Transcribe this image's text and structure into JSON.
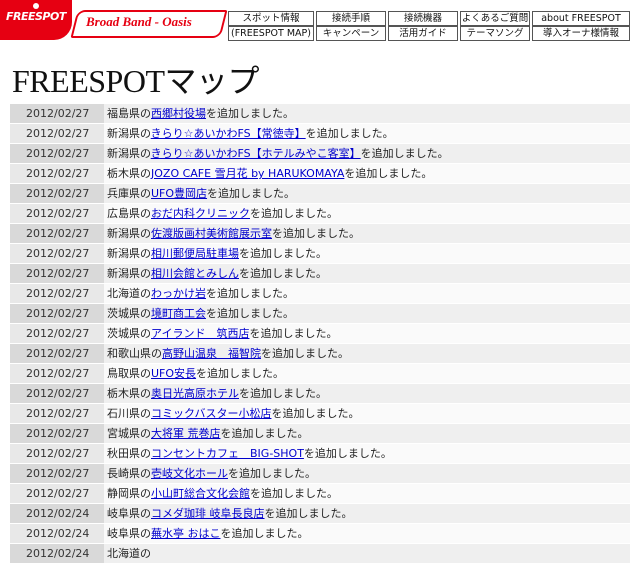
{
  "header": {
    "logo_text": "FREESPOT",
    "brand_text": "Broad Band - Oasis",
    "nav": [
      [
        "スポット情報",
        "(FREESPOT MAP)"
      ],
      [
        "接続手順",
        "キャンペーン"
      ],
      [
        "接続機器",
        "活用ガイド"
      ],
      [
        "よくあるご質問",
        "テーマソング"
      ],
      [
        "about FREESPOT",
        "導入オーナ様情報"
      ]
    ]
  },
  "page_title": "FREESPOTマップ",
  "entries": [
    {
      "date": "2012/02/27",
      "pref": "福島県の",
      "spot": "西郷村役場",
      "suffix": "を追加しました。"
    },
    {
      "date": "2012/02/27",
      "pref": "新潟県の",
      "spot": "きらり☆あいかわFS【常徳寺】",
      "suffix": "を追加しました。"
    },
    {
      "date": "2012/02/27",
      "pref": "新潟県の",
      "spot": "きらり☆あいかわFS【ホテルみやこ客室】",
      "suffix": "を追加しました。"
    },
    {
      "date": "2012/02/27",
      "pref": "栃木県の",
      "spot": "JOZO CAFE 雪月花 by HARUKOMAYA",
      "suffix": "を追加しました。"
    },
    {
      "date": "2012/02/27",
      "pref": "兵庫県の",
      "spot": "UFO豊岡店",
      "suffix": "を追加しました。"
    },
    {
      "date": "2012/02/27",
      "pref": "広島県の",
      "spot": "おだ内科クリニック",
      "suffix": "を追加しました。"
    },
    {
      "date": "2012/02/27",
      "pref": "新潟県の",
      "spot": "佐渡版画村美術館展示室",
      "suffix": "を追加しました。"
    },
    {
      "date": "2012/02/27",
      "pref": "新潟県の",
      "spot": "相川郵便局駐車場",
      "suffix": "を追加しました。"
    },
    {
      "date": "2012/02/27",
      "pref": "新潟県の",
      "spot": "相川会館とみしん",
      "suffix": "を追加しました。"
    },
    {
      "date": "2012/02/27",
      "pref": "北海道の",
      "spot": "わっかけ岩",
      "suffix": "を追加しました。"
    },
    {
      "date": "2012/02/27",
      "pref": "茨城県の",
      "spot": "境町商工会",
      "suffix": "を追加しました。"
    },
    {
      "date": "2012/02/27",
      "pref": "茨城県の",
      "spot": "アイランド　筑西店",
      "suffix": "を追加しました。"
    },
    {
      "date": "2012/02/27",
      "pref": "和歌山県の",
      "spot": "高野山温泉　福智院",
      "suffix": "を追加しました。"
    },
    {
      "date": "2012/02/27",
      "pref": "鳥取県の",
      "spot": "UFO安長",
      "suffix": "を追加しました。"
    },
    {
      "date": "2012/02/27",
      "pref": "栃木県の",
      "spot": "奥日光高原ホテル",
      "suffix": "を追加しました。"
    },
    {
      "date": "2012/02/27",
      "pref": "石川県の",
      "spot": "コミックバスター小松店",
      "suffix": "を追加しました。"
    },
    {
      "date": "2012/02/27",
      "pref": "宮城県の",
      "spot": "大将軍 荒巻店",
      "suffix": "を追加しました。"
    },
    {
      "date": "2012/02/27",
      "pref": "秋田県の",
      "spot": "コンセントカフェ　BIG-SHOT",
      "suffix": "を追加しました。"
    },
    {
      "date": "2012/02/27",
      "pref": "長崎県の",
      "spot": "壱岐文化ホール",
      "suffix": "を追加しました。"
    },
    {
      "date": "2012/02/27",
      "pref": "静岡県の",
      "spot": "小山町総合文化会館",
      "suffix": "を追加しました。"
    },
    {
      "date": "2012/02/24",
      "pref": "岐阜県の",
      "spot": "コメダ珈琲 岐阜長良店",
      "suffix": "を追加しました。"
    },
    {
      "date": "2012/02/24",
      "pref": "岐阜県の",
      "spot": "蕪水亭 おはこ",
      "suffix": "を追加しました。"
    },
    {
      "date": "2012/02/24",
      "pref": "北海道の",
      "spot": "",
      "suffix": ""
    }
  ]
}
